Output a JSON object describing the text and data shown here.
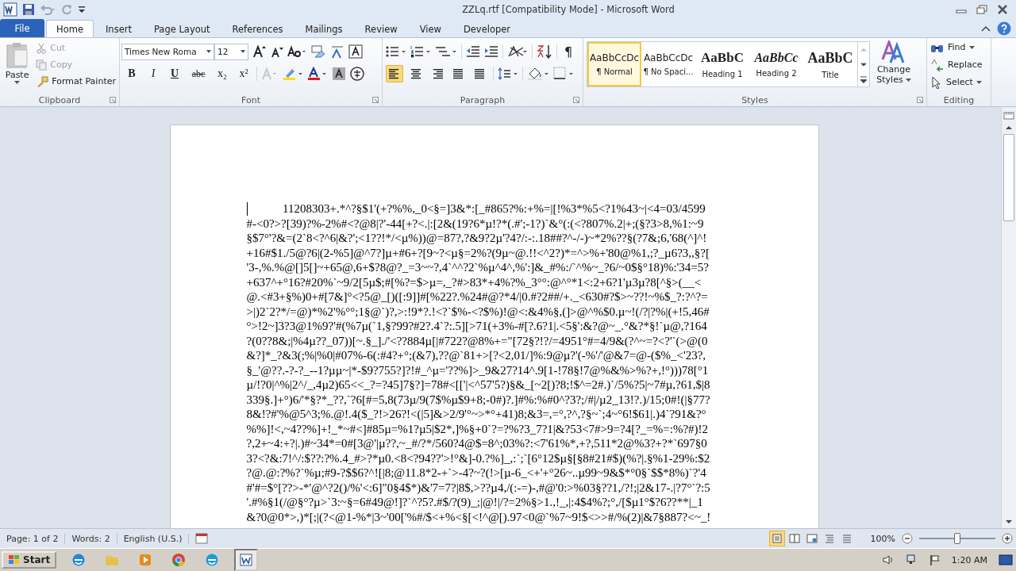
{
  "window": {
    "title": "ZZLq.rtf [Compatibility Mode]  -  Microsoft Word"
  },
  "tabs": [
    {
      "label": "File",
      "kind": "file",
      "selected": false
    },
    {
      "label": "Home",
      "kind": "tab",
      "selected": true
    },
    {
      "label": "Insert",
      "kind": "tab",
      "selected": false
    },
    {
      "label": "Page Layout",
      "kind": "tab",
      "selected": false
    },
    {
      "label": "References",
      "kind": "tab",
      "selected": false
    },
    {
      "label": "Mailings",
      "kind": "tab",
      "selected": false
    },
    {
      "label": "Review",
      "kind": "tab",
      "selected": false
    },
    {
      "label": "View",
      "kind": "tab",
      "selected": false
    },
    {
      "label": "Developer",
      "kind": "tab",
      "selected": false
    }
  ],
  "clipboard": {
    "label": "Clipboard",
    "paste": "Paste",
    "items": [
      {
        "label": "Cut",
        "kind": "cut",
        "disabled": true
      },
      {
        "label": "Copy",
        "kind": "copy",
        "disabled": true
      },
      {
        "label": "Format Painter",
        "kind": "painter",
        "disabled": false
      }
    ]
  },
  "font": {
    "label": "Font",
    "name": "Times New Roma",
    "size": "12",
    "format_buttons": [
      "B",
      "I",
      "U",
      "abc",
      "x₂",
      "x²"
    ]
  },
  "paragraph": {
    "label": "Paragraph",
    "pilcrow": "¶",
    "alignments": [
      {
        "kind": "left",
        "selected": true
      },
      {
        "kind": "center",
        "selected": false
      },
      {
        "kind": "right",
        "selected": false
      },
      {
        "kind": "justify",
        "selected": false
      },
      {
        "kind": "distributed",
        "selected": false
      }
    ]
  },
  "styles": {
    "label": "Styles",
    "items": [
      {
        "preview": "AaBbCcDc",
        "name": "¶ Normal",
        "kind": "normal",
        "selected": true
      },
      {
        "preview": "AaBbCcDc",
        "name": "¶ No Spaci...",
        "kind": "normal",
        "selected": false
      },
      {
        "preview": "AaBbC",
        "name": "Heading 1",
        "kind": "heading",
        "selected": false
      },
      {
        "preview": "AaBbCc",
        "name": "Heading 2",
        "kind": "heading-italic",
        "selected": false
      },
      {
        "preview": "AaBbC",
        "name": "Title",
        "kind": "title",
        "selected": false
      }
    ],
    "change_styles": [
      "Change",
      "Styles"
    ]
  },
  "editing": {
    "label": "Editing",
    "items": [
      {
        "label": "Find",
        "kind": "find"
      },
      {
        "label": "Replace",
        "kind": "replace"
      },
      {
        "label": "Select",
        "kind": "select"
      }
    ]
  },
  "document": {
    "lines": [
      "11208303+.*^?§$1'(+?%%,_0<§=]3&*:[_#865?%:+%=|[!%3*%5<?1%43~|<4=03/4599",
      "#-<0?>?[39)?%-2%#<?@8|?'-44[+?<.|:[2&(19?6*µ!?*(.#';-1?)`&°(:(<?807%.2|+;(§?3>8,%1:~9",
      "§$7°'?&=(2`8<?^6|&?';<1??!*/<µ%))@=87?,?&9?2µ'?4?/:-:.18##?^-/-)~*2%??§(?7&;6,'68(^]^!",
      "+16#$1./5@?6|(2-%5]@^7?]µ+#6+?[9~?<µ§=2%?(9µ~@.!!<^2?)*=^>%+'80@%1,;?_µ6?3,,§?[",
      "'3-,%.%@[]5[]~+65@,6+$?8@?_=3~~?,4`^^?2`%µ^4^,%':]&_#%:/`^%~_?6/~0$§°18)%:'34=5?",
      "+637^+°16?#20%`~9/2[5µ$;#[%?=$>µ=,_?#>83*+4%?%_3°°:@^°*1<:2+6?1'µ3µ?8[^§>(__<",
      "@.<#3+§%)0+#[7&]°<?5@_[)([:9]]#[%22?.%24#@?*4/|0.#?2##/+._<630#?$>~??!~%$_?:?^?=",
      ">|)2`2?*/=@)*%2'%°°;1§@`)?,>:!9*?.!<?`$%-<?$%)!@<:&4%§,(]>@^%$0.µ~!(/?|?%|(+!5,46#",
      "°>!2~]3?3@1%9?'#(%7µ(`1,§?99?#2?.4`?:.5][>71(+3%-#[?.6?1|.<5§':&?@~_.°&?*§!`µ@,?164",
      "?(0??8&;|%4µ??_07))[~.§_]./'<??884µ[|#722?@8%+=\"[72§?!?/=4951°#=4/9&(?^~=?<?'`(>@(0",
      "&?]*_?&3(;%|%0|#07%-6(:#4?+°;(&7),??@`81+>[?<2,01/]%:9@µ?'(-%'/'@&7=@-($%_<'23?,",
      "§_'@??.-?-?_--1?µµ~|*-$9?755?]?!#_^µ='??%]>_9&27?14^.9[1-!78§!7@%&%>%?+,!°)))78[°1",
      "µ/!?0|^%|2^/_,4µ2)65<<_?=?45]7§?]=78#<[['|<^57'5?)§&_[~2[)?8;!$^=2#.)`/5%?5|~7#µ,?61,$|8",
      "339§.]+°)6/'*§?*_??,`?6[#=5,8(73µ/9(7$%µ$9+8;-0#)?.]#%:%#0^?3?;/#|/µ2_13!?.)/15;0#!(|§77?",
      "8&!?#'%@5^3;%.@!.4($_?!>26?!<(|5]&>2/9'°~>*°+41)8;&3=,=°,?^,?§~`;4~°6!$61|.)4`?91&?°",
      "%%]!<,~4??%]+!_*~#<]#85µ=%1?µ5|$2*,]%§+0`?=?%?3_7?1|&?53<7#>9=?4[?_=%=:%?#)!2",
      "?,2+~4:+?|.)#~34*=0#[3@'|µ??,~_#/?*/560?4@$=8^;03%?:<7'61%*,+?,511*2@%3?+?*`697§0",
      "3?<?&:7!^/:$??:?%.4_#>?*µ0.<8<?94??'>!°&]-0.?%]_,:`;`[6°12$µ§[§8#21#$)(%?|.§%1-29%:$2",
      "?@.@:?%?`%µ;#9-?$$6?^![|8;@11.8*2-+`>-4?~?(!>[µ-6_<+'+°26~..µ99~9&$*°0§`$$*8%)`?'4",
      "#'#=$°[??>-*'@^?2()/%'<:6]\"0§4$*)&'7=7?|8$,>??µ4,/(:-=)-,#@'0:>%03§??1,/?!;|2&17-.|?7°`?:5",
      "'.#%§1(/@§°?µ>`3:~§=6#49@!]?`^?5?.#$/?(9)_;|@!|/?=2%§>1.,!_,|:4$4%?;°,/[$µ1°$?6??**|_1",
      "&?0@0*>,)*[;|(?<@1-%*|3~'00['%#/$<+%<§[<!^@[).97<0@`%7~9!$<>>#/%(2)|&7§887?<~_!"
    ]
  },
  "status_bar": {
    "page": "Page: 1 of 2",
    "words": "Words: 2",
    "language": "English (U.S.)",
    "views": [
      {
        "kind": "print",
        "selected": true
      },
      {
        "kind": "read",
        "selected": false
      },
      {
        "kind": "web",
        "selected": false
      },
      {
        "kind": "outline",
        "selected": false
      },
      {
        "kind": "draft",
        "selected": false
      }
    ],
    "zoom": "100%",
    "zoom_slider": {
      "level": 0.5
    }
  },
  "taskbar": {
    "start": "Start",
    "apps": [
      {
        "kind": "ie",
        "selected": false
      },
      {
        "kind": "folder",
        "selected": false
      },
      {
        "kind": "media",
        "selected": false
      },
      {
        "kind": "chrome",
        "selected": false
      },
      {
        "kind": "edge",
        "selected": false
      },
      {
        "kind": "word",
        "selected": true
      }
    ],
    "clock": "1:20 AM"
  }
}
